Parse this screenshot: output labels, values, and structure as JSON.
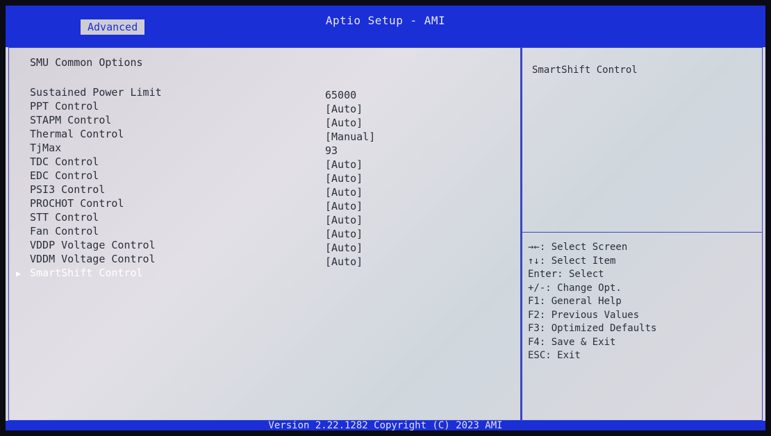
{
  "app": {
    "title": "Aptio Setup - AMI",
    "active_tab": "Advanced"
  },
  "page": {
    "section_title": "SMU Common Options"
  },
  "settings": [
    {
      "label": "Sustained Power Limit",
      "value": "65000"
    },
    {
      "label": "PPT Control",
      "value": "[Auto]"
    },
    {
      "label": "STAPM Control",
      "value": "[Auto]"
    },
    {
      "label": "Thermal Control",
      "value": "[Manual]"
    },
    {
      "label": "TjMax",
      "value": "93"
    },
    {
      "label": "TDC Control",
      "value": "[Auto]"
    },
    {
      "label": "EDC Control",
      "value": "[Auto]"
    },
    {
      "label": "PSI3 Control",
      "value": "[Auto]"
    },
    {
      "label": "PROCHOT Control",
      "value": "[Auto]"
    },
    {
      "label": "STT Control",
      "value": "[Auto]"
    },
    {
      "label": "Fan Control",
      "value": "[Auto]"
    },
    {
      "label": "VDDP Voltage Control",
      "value": "[Auto]"
    },
    {
      "label": "VDDM Voltage Control",
      "value": "[Auto]"
    },
    {
      "label": "SmartShift Control",
      "value": ""
    }
  ],
  "help": {
    "title": "SmartShift Control",
    "keys": [
      "→←: Select Screen",
      "↑↓: Select Item",
      "Enter: Select",
      "+/-: Change Opt.",
      "F1: General Help",
      "F2: Previous Values",
      "F3: Optimized Defaults",
      "F4: Save & Exit",
      "ESC: Exit"
    ]
  },
  "footer": {
    "text": "Version 2.22.1282 Copyright (C) 2023 AMI"
  },
  "colors": {
    "accent": "#1a2fd6",
    "background": "#d8d4dc",
    "selected_text": "#ffffff"
  }
}
